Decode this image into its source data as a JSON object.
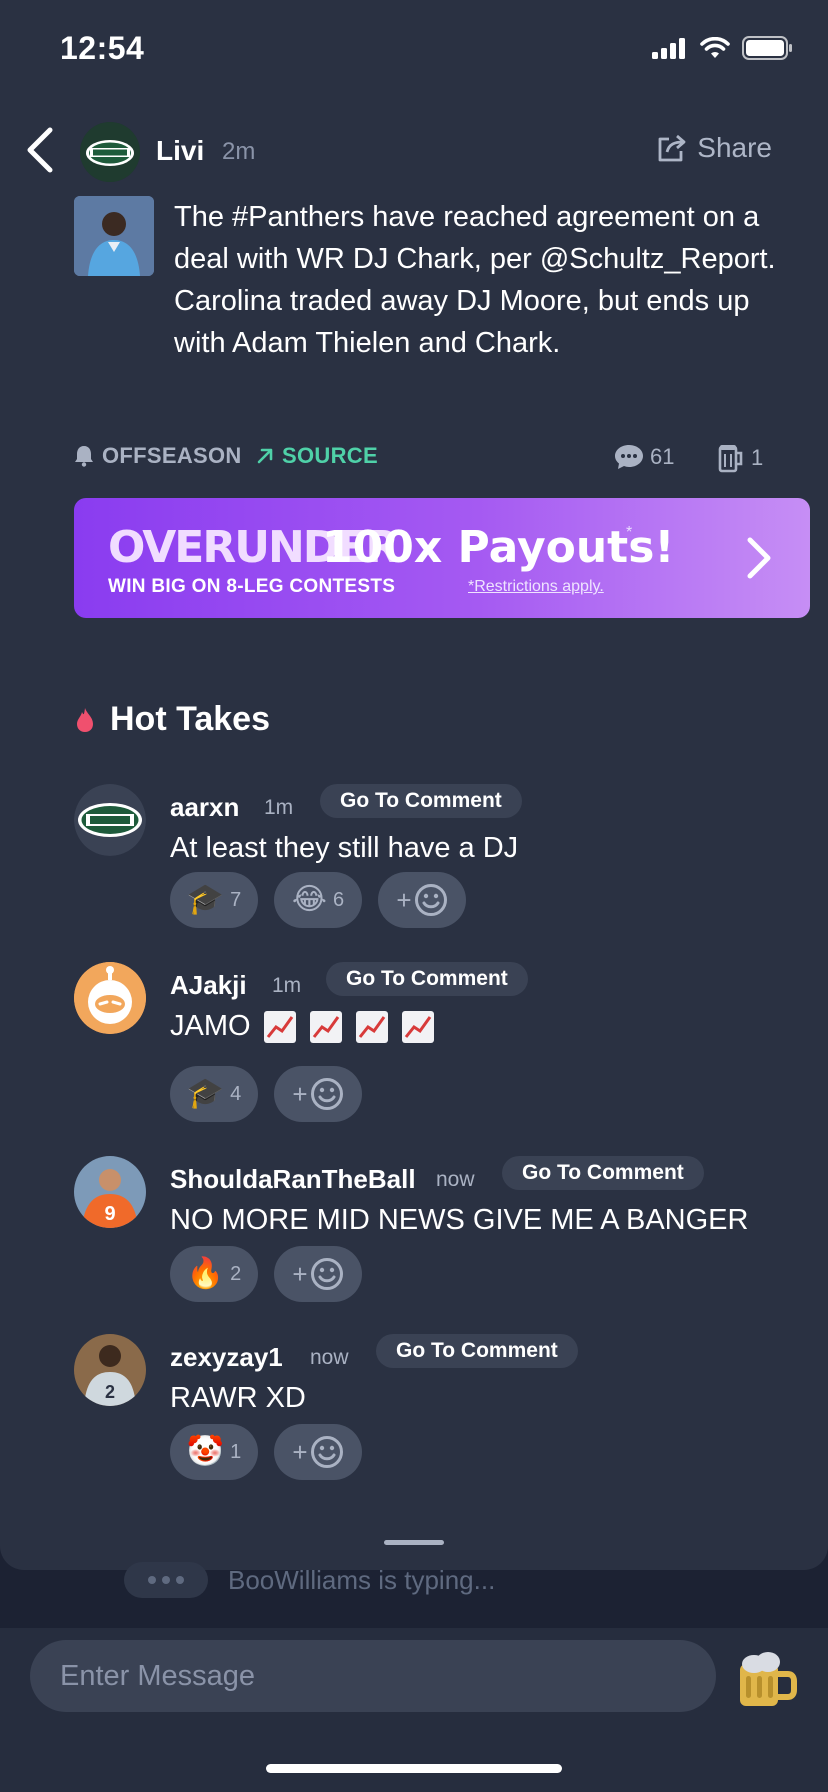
{
  "status_bar": {
    "time": "12:54"
  },
  "header": {
    "author": "Livi",
    "time": "2m",
    "share_label": "Share"
  },
  "post": {
    "text": "The #Panthers have reached agreement on a deal with WR DJ Chark, per @Schultz_Report. Carolina traded away DJ Moore, but ends up with Adam Thielen and Chark.",
    "tag_offseason": "OFFSEASON",
    "tag_source": "SOURCE",
    "comment_count": "61",
    "beer_count": "1"
  },
  "banner": {
    "brand": "OVERUNDER",
    "headline": "100x Payouts!",
    "asterisk": "*",
    "sub": "WIN BIG ON 8-LEG CONTESTS",
    "restrictions": "*Restrictions apply."
  },
  "hot_takes": {
    "title": "Hot Takes",
    "goto_label": "Go To Comment",
    "comments": [
      {
        "user": "aarxn",
        "time": "1m",
        "text": "At least they still have a DJ",
        "reactions": [
          {
            "emoji": "🎓",
            "count": "7"
          },
          {
            "emoji": "😂",
            "count": "6"
          }
        ]
      },
      {
        "user": "AJakji",
        "time": "1m",
        "text": "JAMO",
        "reactions": [
          {
            "emoji": "🎓",
            "count": "4"
          }
        ]
      },
      {
        "user": "ShouldaRanTheBall",
        "time": "now",
        "text": "NO MORE MID NEWS GIVE ME A BANGER",
        "reactions": [
          {
            "emoji": "🔥",
            "count": "2"
          }
        ]
      },
      {
        "user": "zexyzay1",
        "time": "now",
        "text": "RAWR XD",
        "reactions": [
          {
            "emoji": "🤡",
            "count": "1"
          }
        ]
      }
    ]
  },
  "typing": {
    "text": "BooWilliams is typing..."
  },
  "composer": {
    "placeholder": "Enter Message"
  },
  "colors": {
    "background": "#1c2233",
    "sheet": "#2a3142",
    "accent_green": "#4fd1a8",
    "banner_purple": "#8a3cf0"
  }
}
